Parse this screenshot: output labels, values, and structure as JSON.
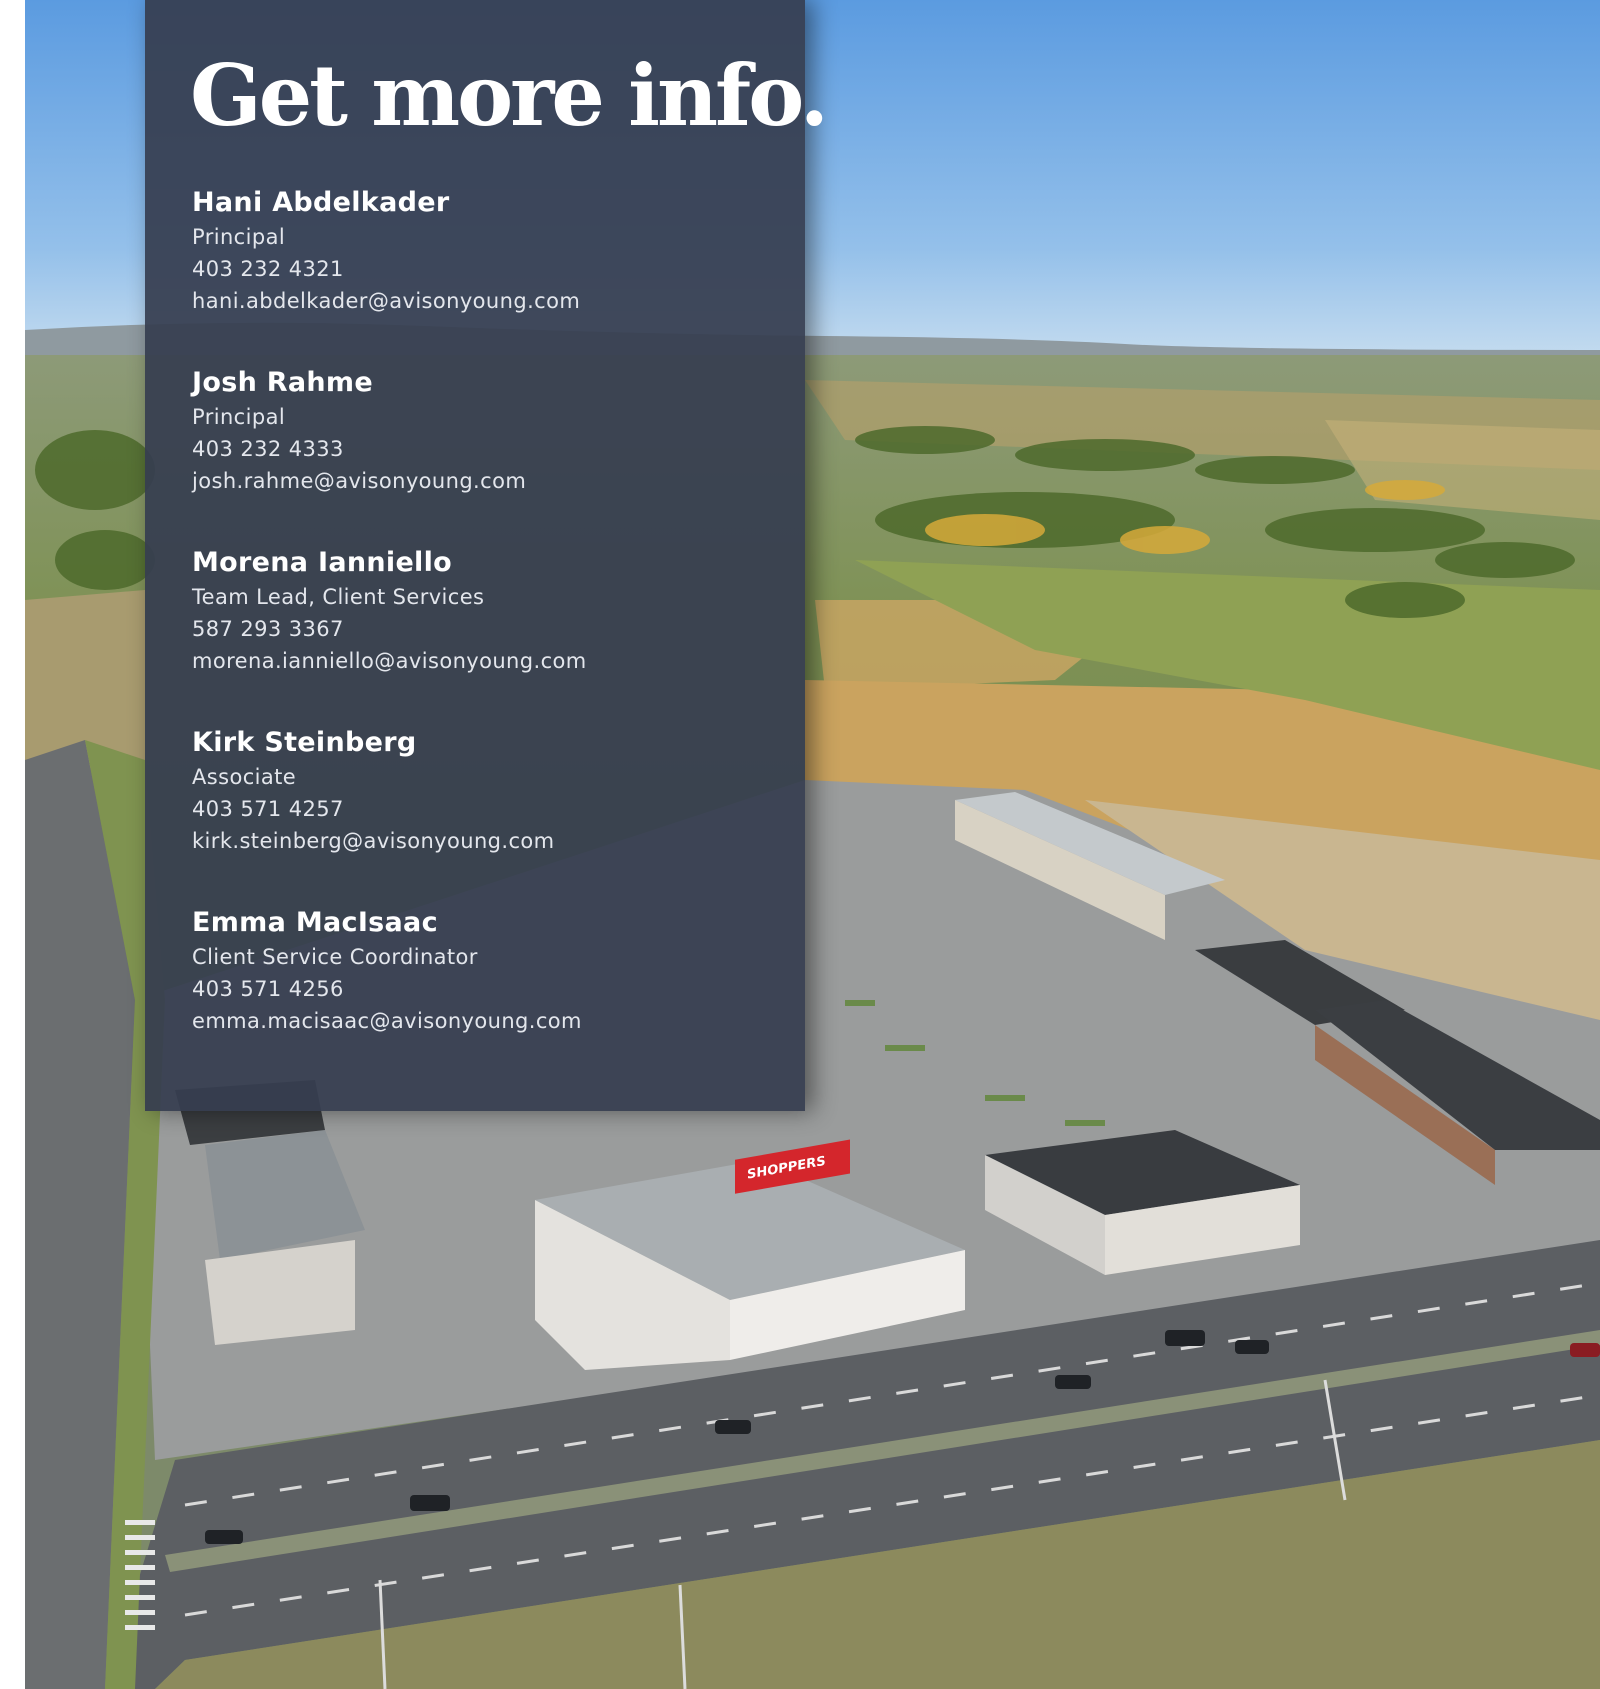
{
  "heading": "Get more info.",
  "contacts": [
    {
      "name": "Hani Abdelkader",
      "title": "Principal",
      "phone": "403 232 4321",
      "email": "hani.abdelkader@avisonyoung.com"
    },
    {
      "name": "Josh Rahme",
      "title": "Principal",
      "phone": "403 232 4333",
      "email": "josh.rahme@avisonyoung.com"
    },
    {
      "name": "Morena Ianniello",
      "title": "Team Lead, Client Services",
      "phone": "587 293 3367",
      "email": "morena.ianniello@avisonyoung.com"
    },
    {
      "name": "Kirk Steinberg",
      "title": "Associate",
      "phone": "403 571 4257",
      "email": "kirk.steinberg@avisonyoung.com"
    },
    {
      "name": "Emma MacIsaac",
      "title": "Client Service Coordinator",
      "phone": "403 571 4256",
      "email": "emma.macisaac@avisonyoung.com"
    }
  ],
  "storefront_sign": "SHOPPERS"
}
